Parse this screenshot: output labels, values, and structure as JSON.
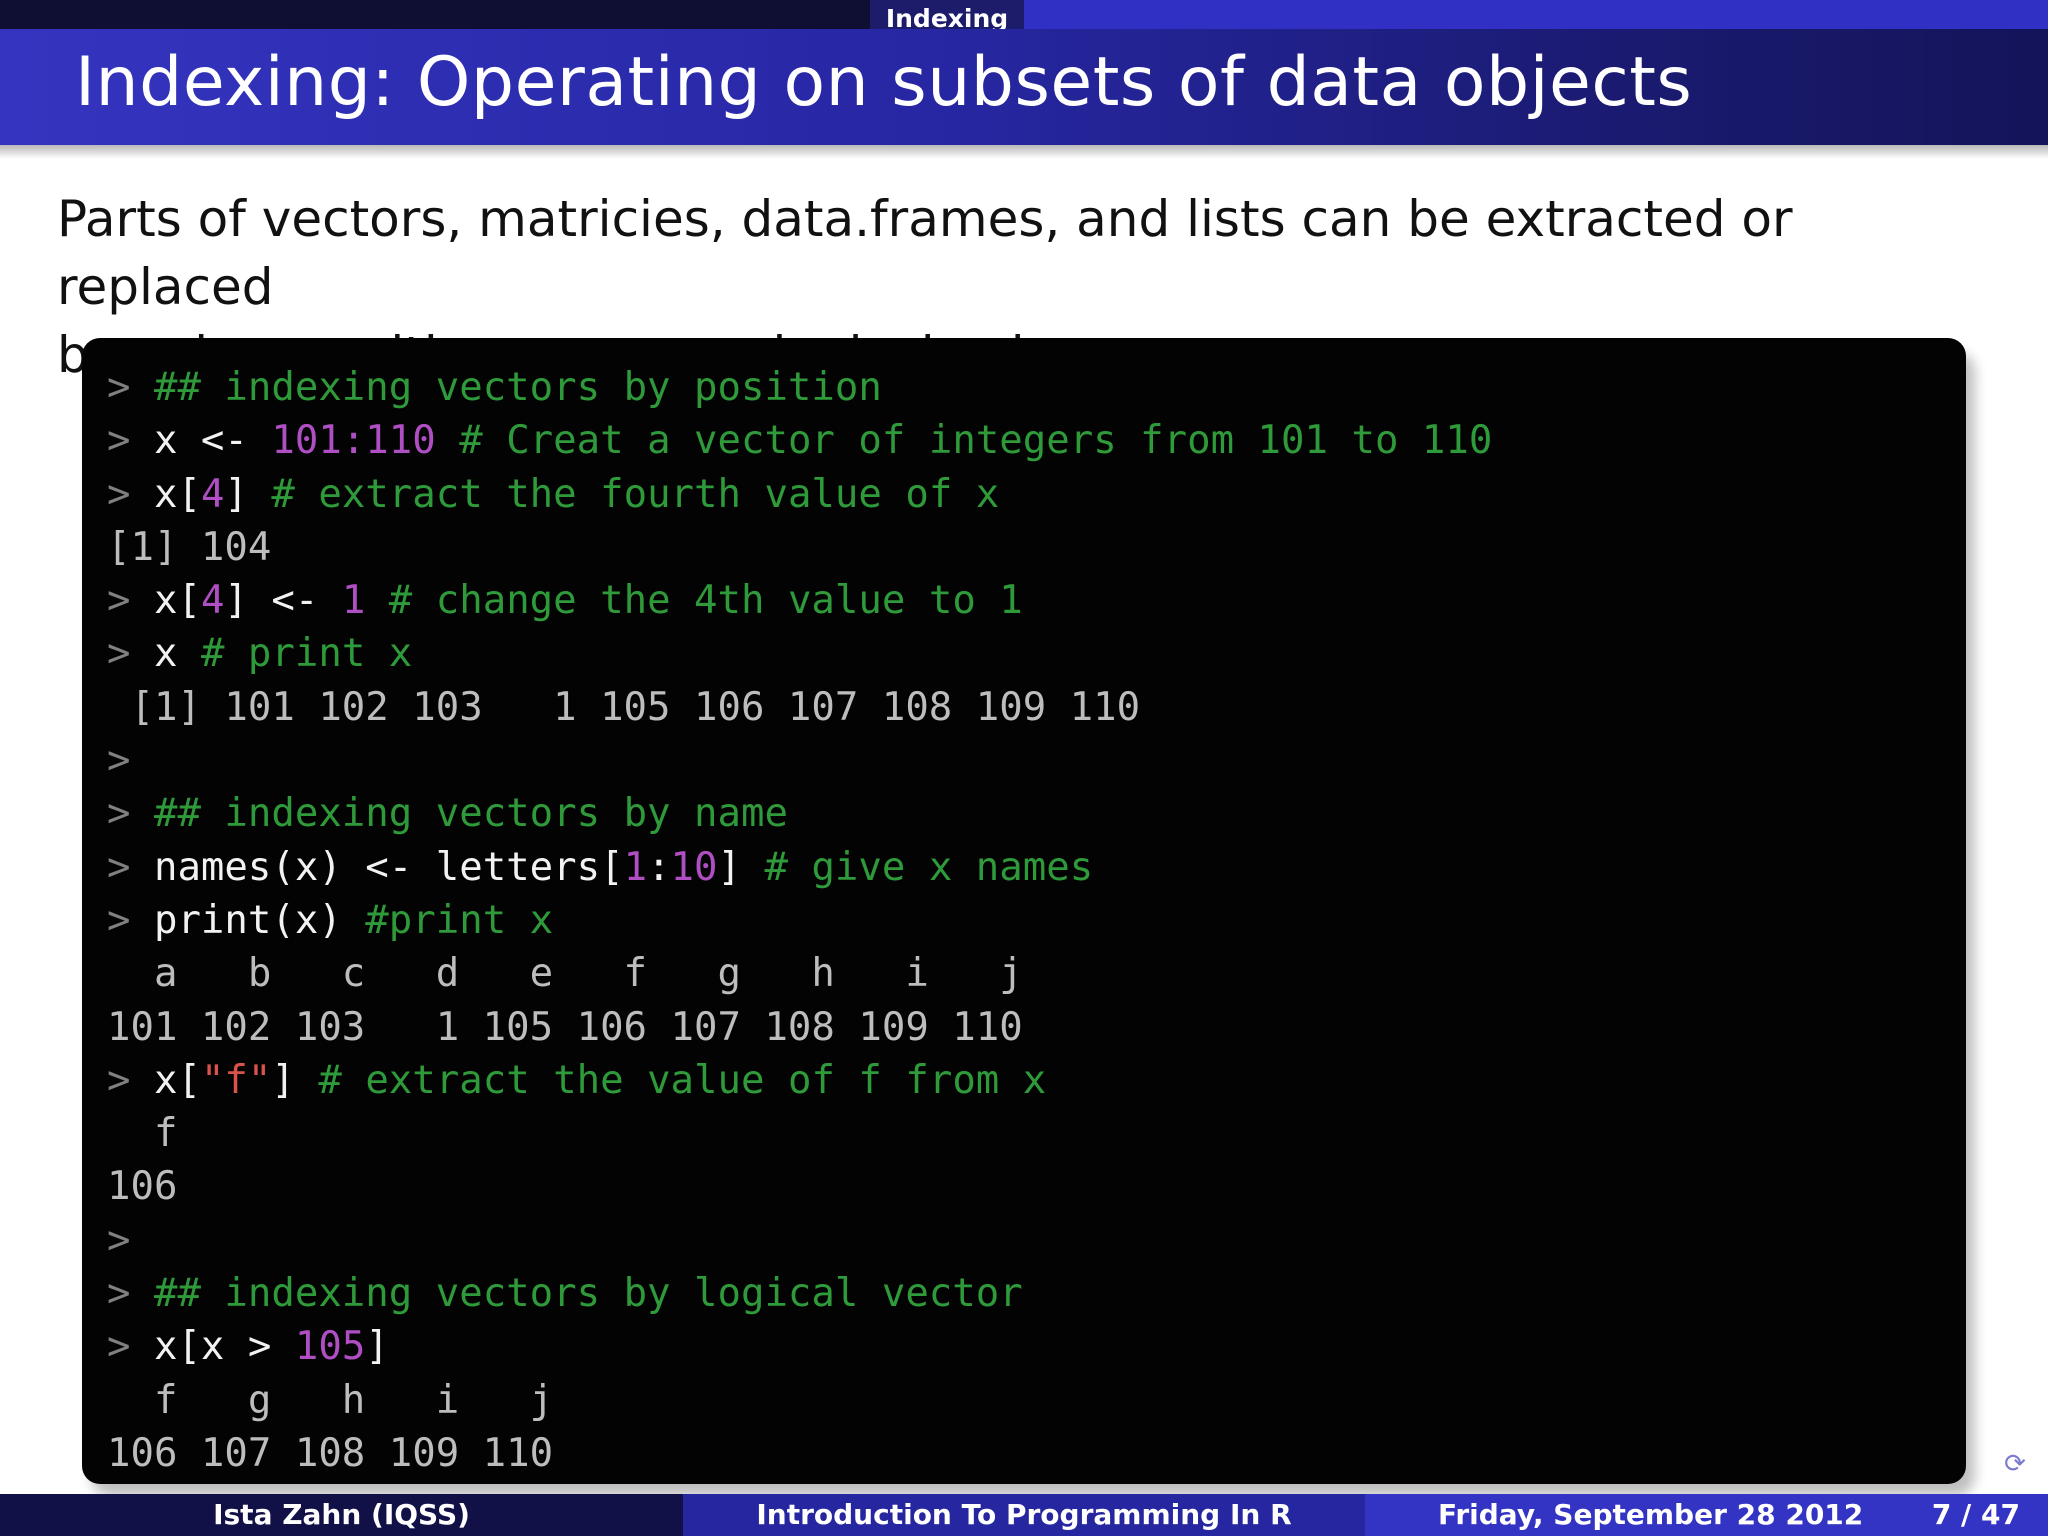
{
  "header": {
    "section": "Indexing",
    "title": "Indexing: Operating on subsets of data objects"
  },
  "intro": {
    "line1": "Parts of vectors, matricies, data.frames, and lists can be extracted or replaced",
    "line2": "based on position, name, or logical values"
  },
  "code": {
    "l1": {
      "prompt": ">",
      "comment": "## indexing vectors by position"
    },
    "l2": {
      "prompt": ">",
      "a": "x <- ",
      "num": "101:110",
      "comment": "# Creat a vector of integers from 101 to 110"
    },
    "l3": {
      "prompt": ">",
      "a": "x[",
      "num": "4",
      "b": "] ",
      "comment": "# extract the fourth value of x"
    },
    "l4": {
      "output": "[1] 104"
    },
    "l5": {
      "prompt": ">",
      "a": "x[",
      "num": "4",
      "b": "] <- ",
      "num2": "1",
      "comment": "# change the 4th value to 1"
    },
    "l6": {
      "prompt": ">",
      "a": "x ",
      "comment": "# print x"
    },
    "l7": {
      "output": " [1] 101 102 103   1 105 106 107 108 109 110"
    },
    "l8": {
      "prompt": ">"
    },
    "l9": {
      "prompt": ">",
      "comment": "## indexing vectors by name"
    },
    "l10": {
      "prompt": ">",
      "a": "names(x) <- letters[",
      "num": "1",
      "mid": ":",
      "num2": "10",
      "b": "] ",
      "comment": "# give x names"
    },
    "l11": {
      "prompt": ">",
      "a": "print(x) ",
      "comment": "#print x"
    },
    "l12": {
      "output": "  a   b   c   d   e   f   g   h   i   j"
    },
    "l13": {
      "output": "101 102 103   1 105 106 107 108 109 110"
    },
    "l14": {
      "prompt": ">",
      "a": "x[",
      "str": "\"f\"",
      "b": "] ",
      "comment": "# extract the value of f from x"
    },
    "l15": {
      "output": "  f"
    },
    "l16": {
      "output": "106"
    },
    "l17": {
      "prompt": ">"
    },
    "l18": {
      "prompt": ">",
      "comment": "## indexing vectors by logical vector"
    },
    "l19": {
      "prompt": ">",
      "a": "x[x > ",
      "num": "105",
      "b": "]"
    },
    "l20": {
      "output": "  f   g   h   i   j"
    },
    "l21": {
      "output": "106 107 108 109 110"
    }
  },
  "footer": {
    "author": "Ista Zahn  (IQSS)",
    "course": "Introduction To Programming In R",
    "date": "Friday, September 28 2012",
    "page": "7 / 47"
  },
  "icons": {
    "nav": "refresh-icon"
  },
  "colors": {
    "title_bar": "#2b2bb0",
    "code_background": "#030303",
    "comment": "#2f9a3a",
    "number": "#b04ec4",
    "string": "#d9534c"
  }
}
